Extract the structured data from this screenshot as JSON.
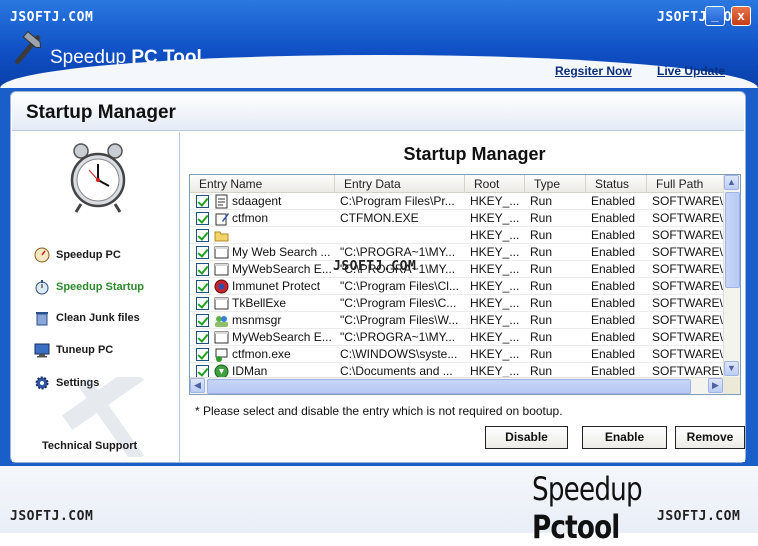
{
  "watermark": "JSOFTJ.COM",
  "header": {
    "app_name_light": "Speedup",
    "app_name_bold": "PC Tool",
    "register_link": "Regsiter Now",
    "update_link": "Live Update",
    "minimize_label": "_",
    "close_label": "x"
  },
  "panel": {
    "title": "Startup Manager"
  },
  "sidebar": {
    "items": [
      {
        "label": "Speedup PC",
        "icon": "speedometer-icon"
      },
      {
        "label": "Speedup Startup",
        "icon": "stopwatch-icon"
      },
      {
        "label": "Clean Junk files",
        "icon": "trash-icon"
      },
      {
        "label": "Tuneup PC",
        "icon": "monitor-icon"
      },
      {
        "label": "Settings",
        "icon": "gear-icon"
      }
    ],
    "support_label": "Technical Support"
  },
  "content": {
    "title": "Startup Manager",
    "columns": [
      "Entry Name",
      "Entry Data",
      "Root",
      "Type",
      "Status",
      "Full Path"
    ],
    "rows": [
      {
        "name": "sdaagent",
        "data": "C:\\Program Files\\Pr...",
        "root": "HKEY_...",
        "type": "Run",
        "status": "Enabled",
        "path": "SOFTWARE\\...",
        "icon": "document-icon"
      },
      {
        "name": "ctfmon",
        "data": "CTFMON.EXE",
        "root": "HKEY_...",
        "type": "Run",
        "status": "Enabled",
        "path": "SOFTWARE\\...",
        "icon": "pen-icon"
      },
      {
        "name": "",
        "data": "",
        "root": "HKEY_...",
        "type": "Run",
        "status": "Enabled",
        "path": "SOFTWARE\\...",
        "icon": "folder-icon"
      },
      {
        "name": "My Web Search ...",
        "data": "\"C:\\PROGRA~1\\MY...",
        "root": "HKEY_...",
        "type": "Run",
        "status": "Enabled",
        "path": "SOFTWARE\\...",
        "icon": "window-icon"
      },
      {
        "name": "MyWebSearch E...",
        "data": "\"C:\\PROGRA~1\\MY...",
        "root": "HKEY_...",
        "type": "Run",
        "status": "Enabled",
        "path": "SOFTWARE\\...",
        "icon": "window-icon"
      },
      {
        "name": "Immunet Protect",
        "data": "\"C:\\Program Files\\Cl...",
        "root": "HKEY_...",
        "type": "Run",
        "status": "Enabled",
        "path": "SOFTWARE\\...",
        "icon": "shield-icon"
      },
      {
        "name": "TkBellExe",
        "data": "\"C:\\Program Files\\C...",
        "root": "HKEY_...",
        "type": "Run",
        "status": "Enabled",
        "path": "SOFTWARE\\...",
        "icon": "window-icon"
      },
      {
        "name": "msnmsgr",
        "data": "\"C:\\Program Files\\W...",
        "root": "HKEY_...",
        "type": "Run",
        "status": "Enabled",
        "path": "SOFTWARE\\...",
        "icon": "messenger-icon"
      },
      {
        "name": "MyWebSearch E...",
        "data": "\"C:\\PROGRA~1\\MY...",
        "root": "HKEY_...",
        "type": "Run",
        "status": "Enabled",
        "path": "SOFTWARE\\...",
        "icon": "window-icon"
      },
      {
        "name": "ctfmon.exe",
        "data": "C:\\WINDOWS\\syste...",
        "root": "HKEY_...",
        "type": "Run",
        "status": "Enabled",
        "path": "SOFTWARE\\...",
        "icon": "network-icon"
      },
      {
        "name": "IDMan",
        "data": "C:\\Documents and ...",
        "root": "HKEY_...",
        "type": "Run",
        "status": "Enabled",
        "path": "SOFTWARE\\...",
        "icon": "download-icon"
      }
    ],
    "note": "* Please select and disable the entry which is not required on bootup.",
    "buttons": {
      "disable": "Disable",
      "enable": "Enable",
      "remove": "Remove"
    }
  },
  "footer": {
    "brand_light": "Speedup",
    "brand_bold": "Pctool"
  }
}
